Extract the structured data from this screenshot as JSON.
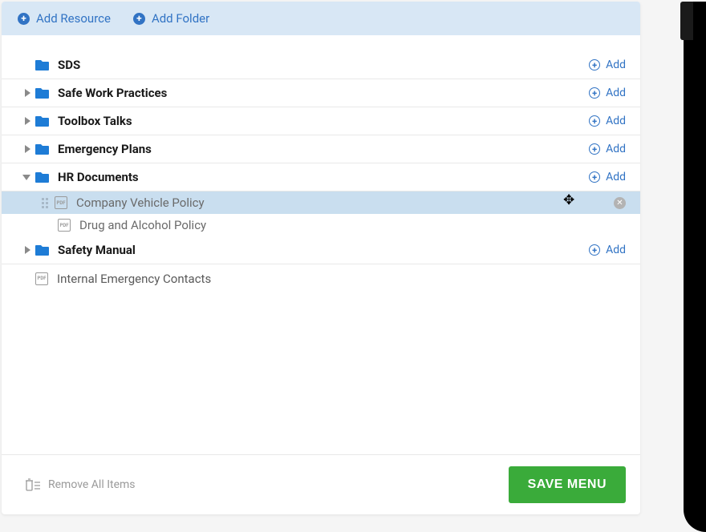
{
  "colors": {
    "link": "#3173c4",
    "save": "#3aab3a",
    "folder": "#1e7cd6",
    "muted": "#9a9a9a"
  },
  "toolbar": {
    "add_resource": "Add Resource",
    "add_folder": "Add Folder"
  },
  "add_label": "Add",
  "tree": {
    "folders": [
      {
        "label": "SDS",
        "expandable": false,
        "expanded": false
      },
      {
        "label": "Safe Work Practices",
        "expandable": true,
        "expanded": false
      },
      {
        "label": "Toolbox Talks",
        "expandable": true,
        "expanded": false
      },
      {
        "label": "Emergency Plans",
        "expandable": true,
        "expanded": false
      },
      {
        "label": "HR Documents",
        "expandable": true,
        "expanded": true,
        "children": [
          {
            "label": "Company Vehicle Policy",
            "selected": true
          },
          {
            "label": "Drug and Alcohol Policy",
            "selected": false
          }
        ]
      },
      {
        "label": "Safety Manual",
        "expandable": true,
        "expanded": false
      }
    ],
    "root_docs": [
      {
        "label": "Internal Emergency Contacts"
      }
    ]
  },
  "pdf_badge": "PDF",
  "footer": {
    "remove_all": "Remove All Items",
    "save": "SAVE MENU"
  }
}
